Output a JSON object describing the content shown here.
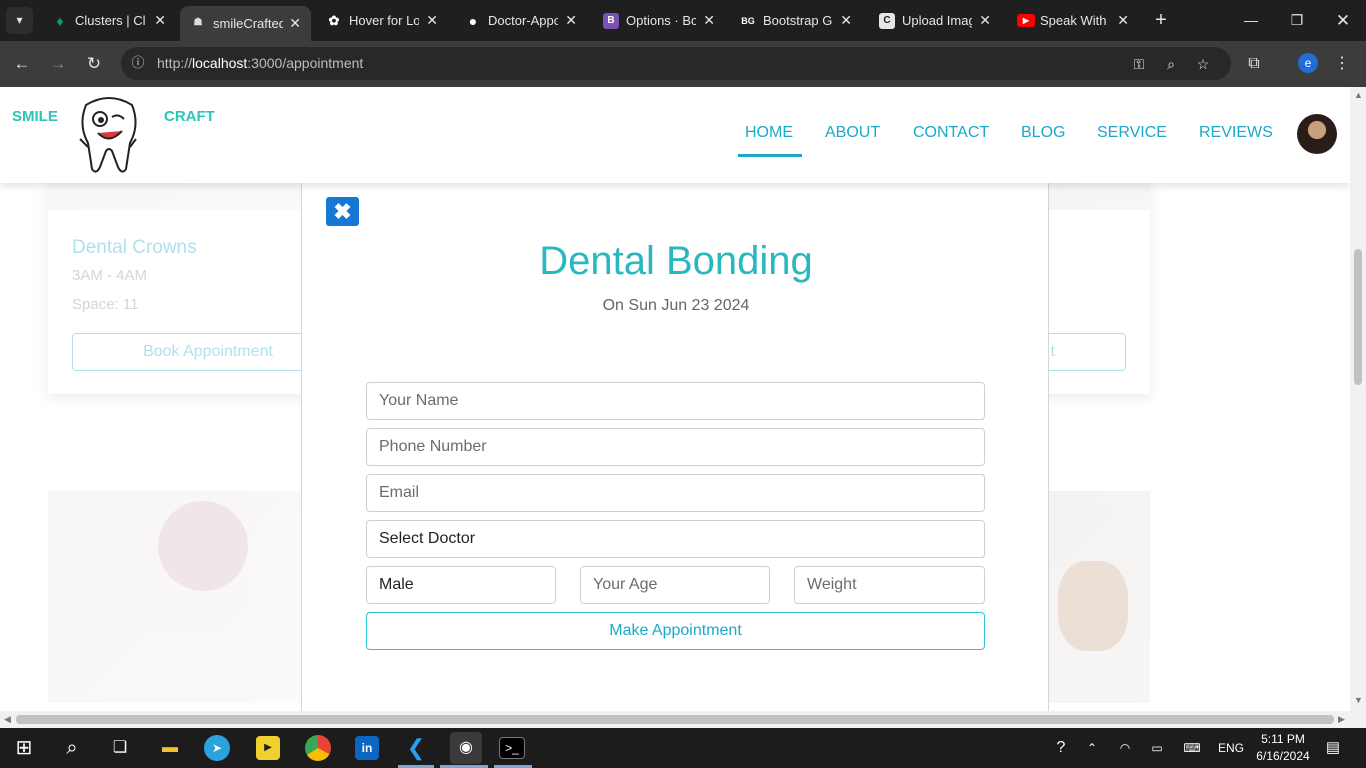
{
  "browser": {
    "tabs": [
      {
        "title": "Clusters | Clo",
        "icon": "leaf-icon",
        "color": "#00a35c"
      },
      {
        "title": "smileCrafted",
        "icon": "tooth-icon",
        "color": "#dddddd"
      },
      {
        "title": "Hover for Lo",
        "icon": "openai-icon",
        "color": "#ffffff"
      },
      {
        "title": "Doctor-Appo",
        "icon": "github-icon",
        "color": "#ffffff"
      },
      {
        "title": "Options · Bo",
        "icon": "bootstrap-icon",
        "color": "#7952b3"
      },
      {
        "title": "Bootstrap Ga",
        "icon": "bg-icon",
        "color": "#ffffff"
      },
      {
        "title": "Upload Imag",
        "icon": "c-icon",
        "color": "#dddddd"
      },
      {
        "title": "Speak With I",
        "icon": "youtube-icon",
        "color": "#ff0000"
      }
    ],
    "bootstrap_glyph": "B",
    "bg_glyph": "BG",
    "c_glyph": "C",
    "url_prefix": "http://",
    "url_host": "localhost",
    "url_rest": ":3000/appointment",
    "profile_initial": "e"
  },
  "header": {
    "brand_left": "SMILE",
    "brand_right": "CRAFT",
    "nav": [
      "HOME",
      "ABOUT",
      "CONTACT",
      "BLOG",
      "SERVICE",
      "REVIEWS"
    ]
  },
  "background_cards": {
    "left_title": "Dental Crowns",
    "left_time": "3AM - 4AM",
    "left_space": "Space: 11",
    "left_button": "Book Appointment",
    "right_button_partial": "t"
  },
  "modal": {
    "close_label": "✖",
    "title": "Dental Bonding",
    "date": "On Sun Jun 23 2024",
    "name_placeholder": "Your Name",
    "phone_placeholder": "Phone Number",
    "email_placeholder": "Email",
    "doctor_value": "Select Doctor",
    "gender_value": "Male",
    "age_placeholder": "Your Age",
    "weight_placeholder": "Weight",
    "submit_label": "Make Appointment"
  },
  "taskbar": {
    "time": "5:11 PM",
    "date": "6/16/2024",
    "language": "ENG"
  },
  "colors": {
    "accent": "#1aa9c8",
    "brand_teal": "#2cc5b5",
    "close_blue": "#1677d4"
  }
}
